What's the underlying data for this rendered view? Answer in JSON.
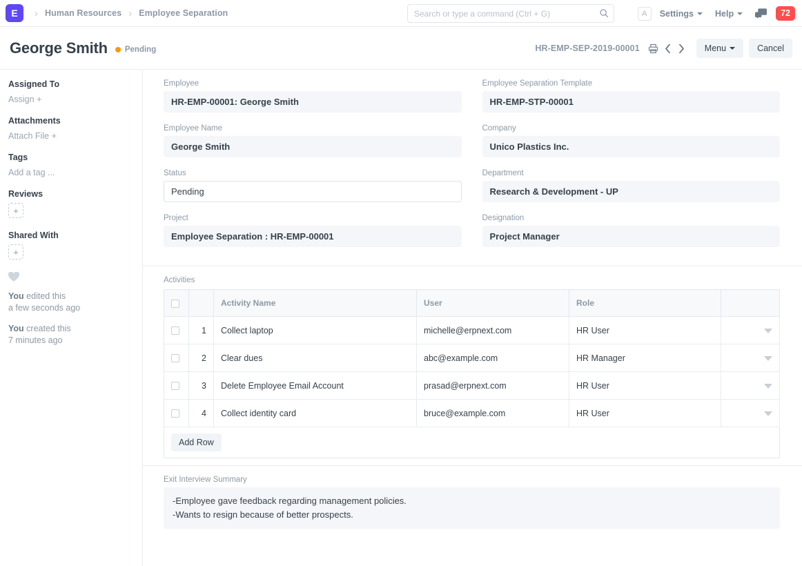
{
  "navbar": {
    "logo_letter": "E",
    "breadcrumbs": [
      "Human Resources",
      "Employee Separation"
    ],
    "search_placeholder": "Search or type a command (Ctrl + G)",
    "search_value": "",
    "avatar_letter": "A",
    "settings_label": "Settings",
    "help_label": "Help",
    "notification_count": "72"
  },
  "page_head": {
    "title": "George Smith",
    "status": "Pending",
    "status_color": "#ff9800",
    "doc_name": "HR-EMP-SEP-2019-00001",
    "menu_label": "Menu",
    "cancel_label": "Cancel"
  },
  "sidebar": {
    "assigned_to_label": "Assigned To",
    "assign_label": "Assign",
    "attachments_label": "Attachments",
    "attach_file_label": "Attach File",
    "tags_label": "Tags",
    "add_tag_label": "Add a tag ...",
    "reviews_label": "Reviews",
    "shared_with_label": "Shared With",
    "plus_glyph": "+",
    "activity": [
      {
        "who": "You",
        "what": " edited this",
        "when": "a few seconds ago"
      },
      {
        "who": "You",
        "what": " created this",
        "when": "7 minutes ago"
      }
    ]
  },
  "form": {
    "left": [
      {
        "label": "Employee",
        "value": "HR-EMP-00001: George Smith",
        "editable": false
      },
      {
        "label": "Employee Name",
        "value": "George Smith",
        "editable": false
      },
      {
        "label": "Status",
        "value": "Pending",
        "editable": true
      },
      {
        "label": "Project",
        "value": "Employee Separation : HR-EMP-00001",
        "editable": false
      }
    ],
    "right": [
      {
        "label": "Employee Separation Template",
        "value": "HR-EMP-STP-00001",
        "editable": false
      },
      {
        "label": "Company",
        "value": "Unico Plastics Inc.",
        "editable": false
      },
      {
        "label": "Department",
        "value": "Research & Development - UP",
        "editable": false
      },
      {
        "label": "Designation",
        "value": "Project Manager",
        "editable": false
      }
    ]
  },
  "activities": {
    "label": "Activities",
    "columns": [
      "Activity Name",
      "User",
      "Role"
    ],
    "rows": [
      {
        "idx": "1",
        "name": "Collect laptop",
        "user": "michelle@erpnext.com",
        "role": "HR User"
      },
      {
        "idx": "2",
        "name": "Clear dues",
        "user": "abc@example.com",
        "role": "HR Manager"
      },
      {
        "idx": "3",
        "name": "Delete Employee Email Account",
        "user": "prasad@erpnext.com",
        "role": "HR User"
      },
      {
        "idx": "4",
        "name": "Collect identity card",
        "user": "bruce@example.com",
        "role": "HR User"
      }
    ],
    "add_row_label": "Add Row"
  },
  "exit_interview": {
    "label": "Exit Interview Summary",
    "line1": "-Employee gave feedback regarding management policies.",
    "line2": "-Wants to resign because of better prospects."
  }
}
